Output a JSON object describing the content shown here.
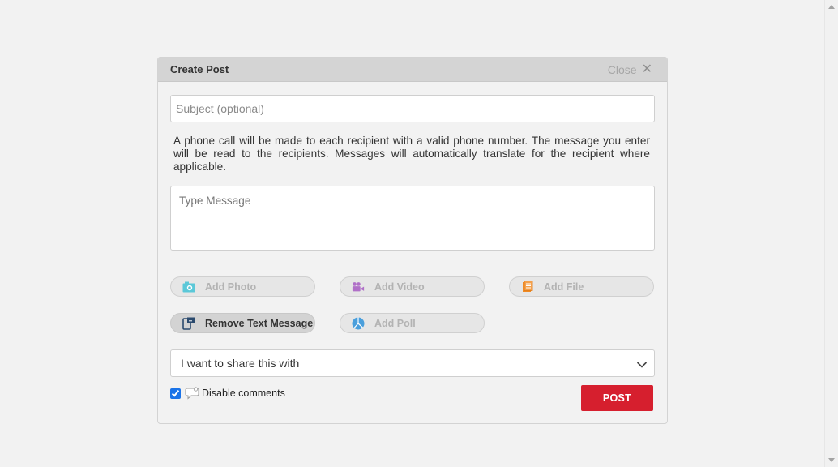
{
  "modal": {
    "title": "Create Post",
    "close_label": "Close",
    "subject_placeholder": "Subject (optional)",
    "info_text": "A phone call will be made to each recipient with a valid phone number. The message you enter will be read to the recipients. Messages will automatically translate for the recipient where applicable.",
    "message_placeholder": "Type Message",
    "actions": [
      {
        "label": "Add Photo",
        "icon": "camera-icon",
        "active": false
      },
      {
        "label": "Add Video",
        "icon": "video-camera-icon",
        "active": false
      },
      {
        "label": "Add File",
        "icon": "file-icon",
        "active": false
      },
      {
        "label": "Remove Text Message",
        "icon": "phone-message-icon",
        "active": true
      },
      {
        "label": "Add Poll",
        "icon": "pie-chart-icon",
        "active": false
      }
    ],
    "share_label": "I want to share this with",
    "disable_comments_label": "Disable comments",
    "disable_comments_checked": true,
    "post_label": "POST"
  },
  "colors": {
    "post_button": "#d61f2e",
    "photo_icon": "#5bc8d8",
    "video_icon": "#b070c8",
    "file_icon": "#f08a24",
    "poll_icon": "#4a9fdc"
  }
}
